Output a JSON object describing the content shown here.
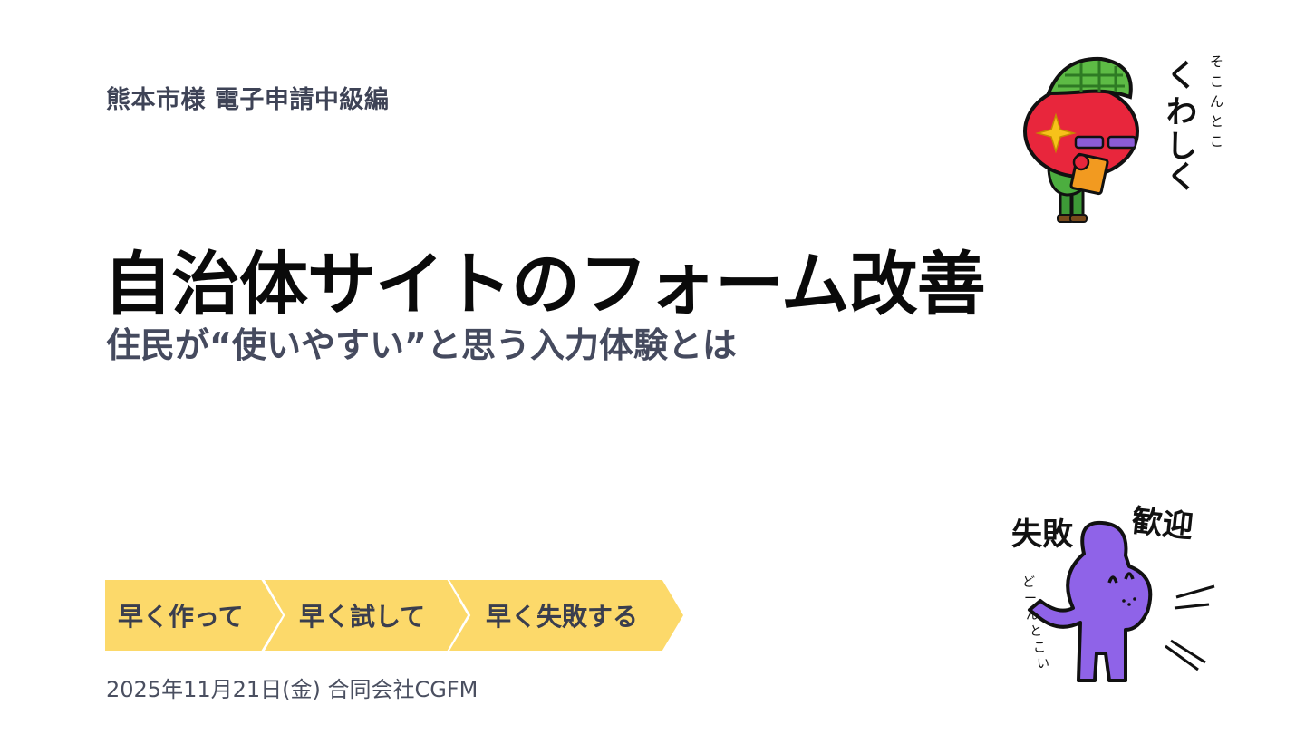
{
  "slide": {
    "series_title": "熊本市様 電子申請中級編",
    "main_title": "自治体サイトのフォーム改善",
    "subtitle": "住民が“使いやすい”と思う入力体験とは",
    "steps": [
      "早く作って",
      "早く試して",
      "早く失敗する"
    ],
    "footer": "2025年11月21日(金) 合同会社CGFM",
    "accent_color": "#fcd96a",
    "text_color": "#3e4356"
  },
  "stickers": {
    "tomato": {
      "icon": "tomato-detective-icon",
      "caption_large": "くわしく",
      "caption_small": "そこんとこ"
    },
    "purple": {
      "icon": "purple-character-icon",
      "caption_left": "失敗",
      "caption_right": "歓迎",
      "caption_side": "どーんとこい"
    }
  }
}
